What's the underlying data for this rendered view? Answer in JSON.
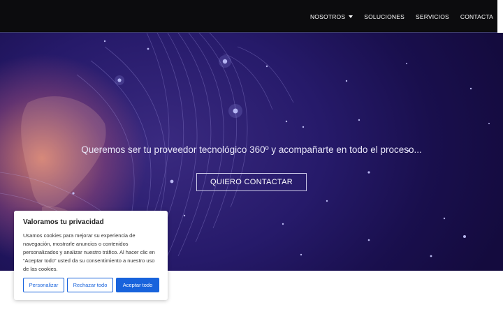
{
  "nav": {
    "items": [
      {
        "label": "NOSOTROS",
        "has_dropdown": true
      },
      {
        "label": "SOLUCIONES",
        "has_dropdown": false
      },
      {
        "label": "SERVICIOS",
        "has_dropdown": false
      },
      {
        "label": "CONTACTA",
        "has_dropdown": false
      }
    ],
    "dropdown_icon": "caret-down-icon"
  },
  "hero": {
    "headline": "Queremos ser tu proveedor tecnológico 360º y acompañarte en todo el proceso...",
    "cta_label": "QUIERO CONTACTAR"
  },
  "cookie_banner": {
    "title": "Valoramos tu privacidad",
    "text": "Usamos cookies para mejorar su experiencia de navegación, mostrarle anuncios o contenidos personalizados y analizar nuestro tráfico. Al hacer clic en “Aceptar todo” usted da su consentimiento a nuestro uso de las cookies.",
    "buttons": {
      "customize": "Personalizar",
      "reject": "Rechazar todo",
      "accept": "Aceptar todo"
    }
  },
  "colors": {
    "header_bg": "#0c0c0e",
    "hero_bg": "#1f1460",
    "accent_blue": "#1863dc"
  }
}
